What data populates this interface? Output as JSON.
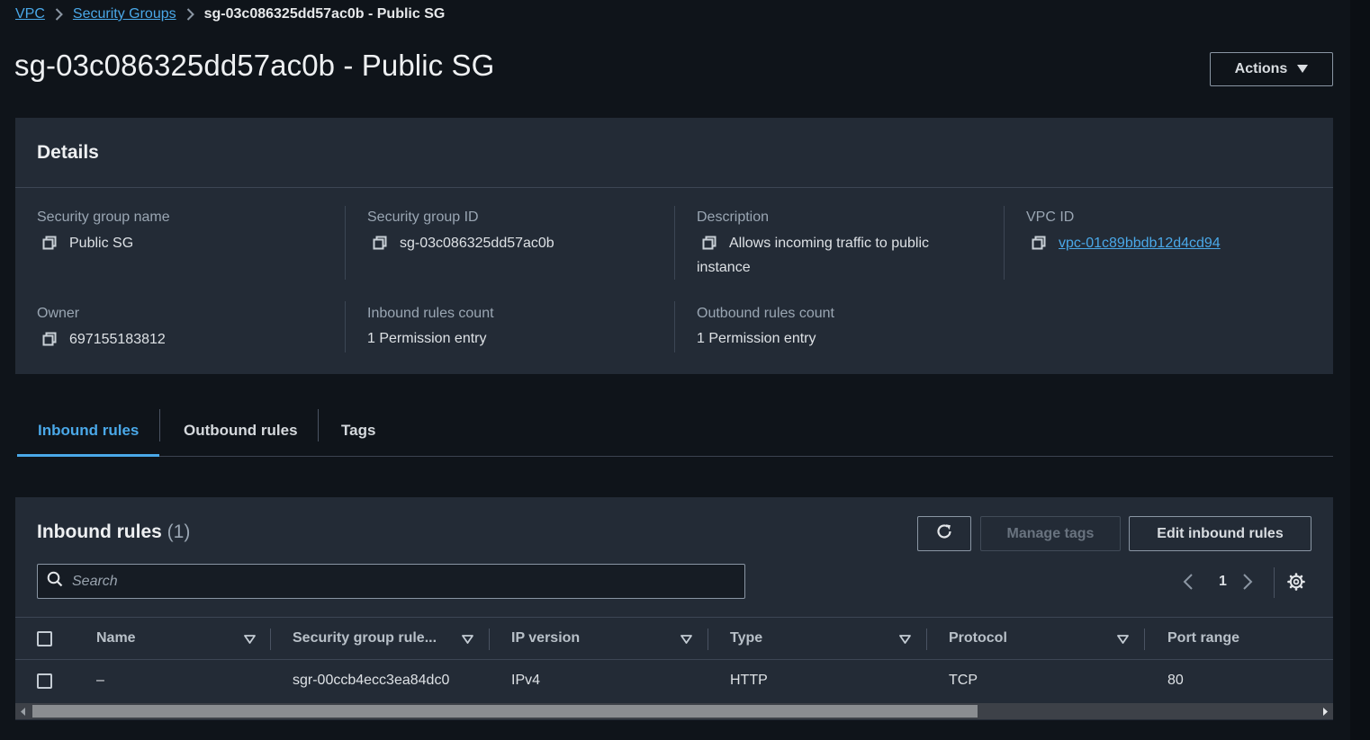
{
  "breadcrumb": {
    "vpc": "VPC",
    "security_groups": "Security Groups",
    "current": "sg-03c086325dd57ac0b - Public SG"
  },
  "page_title": "sg-03c086325dd57ac0b - Public SG",
  "actions_label": "Actions",
  "details": {
    "heading": "Details",
    "sg_name": {
      "label": "Security group name",
      "value": "Public SG"
    },
    "sg_id": {
      "label": "Security group ID",
      "value": "sg-03c086325dd57ac0b"
    },
    "description": {
      "label": "Description",
      "line1": "Allows incoming traffic to public",
      "line2": "instance"
    },
    "vpc_id": {
      "label": "VPC ID",
      "value": "vpc-01c89bbdb12d4cd94"
    },
    "owner": {
      "label": "Owner",
      "value": "697155183812"
    },
    "inbound_count": {
      "label": "Inbound rules count",
      "value": "1 Permission entry"
    },
    "outbound_count": {
      "label": "Outbound rules count",
      "value": "1 Permission entry"
    }
  },
  "tabs": [
    {
      "label": "Inbound rules",
      "active": true
    },
    {
      "label": "Outbound rules",
      "active": false
    },
    {
      "label": "Tags",
      "active": false
    }
  ],
  "inbound": {
    "title": "Inbound rules",
    "count": "(1)",
    "manage_tags": "Manage tags",
    "edit_rules": "Edit inbound rules",
    "search_placeholder": "Search",
    "page": "1",
    "columns": [
      "Name",
      "Security group rule...",
      "IP version",
      "Type",
      "Protocol",
      "Port range"
    ],
    "rows": [
      {
        "name": "–",
        "rule_id": "sgr-00ccb4ecc3ea84dc0",
        "ip_version": "IPv4",
        "type": "HTTP",
        "protocol": "TCP",
        "port_range": "80"
      }
    ]
  },
  "colors": {
    "link": "#4aa8e8",
    "panel": "#232b36",
    "background": "#0f141a"
  },
  "icons": [
    "chevron-right-icon",
    "caret-down-icon",
    "copy-icon",
    "refresh-icon",
    "search-icon",
    "chevron-left-icon",
    "gear-icon",
    "sort-down-icon"
  ]
}
